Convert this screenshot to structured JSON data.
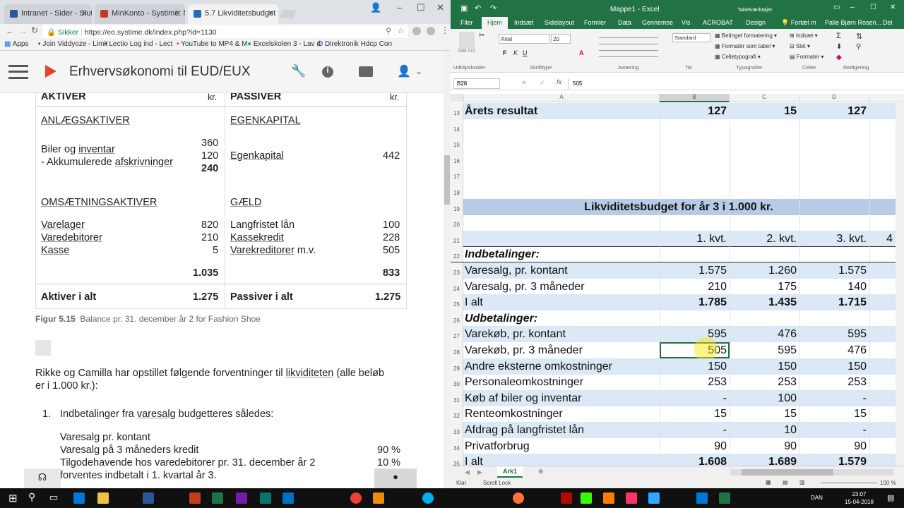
{
  "chrome": {
    "tabs": [
      {
        "label": "Intranet - Sider - Slut m"
      },
      {
        "label": "MinKonto - Systime: Min"
      },
      {
        "label": "5.7 Likviditetsbudget (DC"
      }
    ],
    "secure_label": "Sikker",
    "url": "https://eo.systime.dk/index.php?id=1130",
    "bookmarks": [
      "Apps",
      "Join Viddyoze - Limit",
      "Lectio Log ind - Lect",
      "YouTube to MP4 & M",
      "Excelskolen 3 - Lav d",
      "Direktronik Hdcp Con"
    ]
  },
  "app": {
    "title": "Erhvervsøkonomi til EUD/EUX"
  },
  "balance": {
    "aktiver_header": "AKTIVER",
    "passiver_header": "PASSIVER",
    "currency": "kr.",
    "anlaeg_header": "ANLÆGSAKTIVER",
    "egenkapital_header": "EGENKAPITAL",
    "biler_label": "Biler og",
    "inventar_label": "inventar",
    "akkum_prefix": "- Akkumulerede",
    "afskrivninger_label": "afskrivninger",
    "v360": "360",
    "v120": "120",
    "v240": "240",
    "egenkapital_label": "Egenkapital",
    "v442": "442",
    "oms_header": "OMSÆTNINGSAKTIVER",
    "gaeld_header": "GÆLD",
    "varelager": "Varelager",
    "varedebitorer": "Varedebitorer",
    "kasse": "Kasse",
    "v820": "820",
    "v210": "210",
    "v5": "5",
    "langfristet": "Langfristet lån",
    "kassekredit": "Kassekredit",
    "varekreditorer": "Varekreditorer",
    "mv": "m.v.",
    "v100": "100",
    "v228": "228",
    "v505": "505",
    "sum_oms": "1.035",
    "sum_gaeld": "833",
    "aktiver_i_alt": "Aktiver i alt",
    "passiver_i_alt": "Passiver i alt",
    "total_a": "1.275",
    "total_p": "1.275"
  },
  "figure": {
    "label": "Figur 5.15",
    "caption": "Balance pr. 31. december år 2 for Fashion Shoe"
  },
  "text": {
    "intro_a": "Rikke og Camilla har opstillet følgende forventninger til",
    "intro_link": "likviditeten",
    "intro_b": "(alle beløb",
    "intro_line2": "er i 1.000 kr.):",
    "item1_num": "1.",
    "item1_a": "Indbetalinger fra",
    "item1_link": "varesalg",
    "item1_b": "budgetteres således:",
    "sub1": "Varesalg pr. kontant",
    "sub2": "Varesalg på 3 måneders kredit",
    "sub2_val": "90 %",
    "sub3": "Tilgodehavende hos varedebitorer pr. 31. december år 2",
    "sub3_val": "10 %",
    "sub4": "forventes indbetalt i 1. kvartal år 3."
  },
  "excel": {
    "title": "Mappe1 - Excel",
    "context_label": "Tabelværktøjer",
    "user": "Palle Bjørn Rosen...",
    "tabs": [
      "Filer",
      "Hjem",
      "Indsæt",
      "Sidelayout",
      "Formler",
      "Data",
      "Gennemse",
      "Vis",
      "ACROBAT",
      "Design",
      "Fortæl m",
      "Del"
    ],
    "ribbon": {
      "paste": "Sæt ind",
      "font": "Arial",
      "size": "20",
      "number_format": "Standard",
      "cond_format": "Betinget formatering",
      "format_table": "Formatér som tabel",
      "cell_styles": "Celletypografi",
      "insert": "Indsæt",
      "delete": "Slet",
      "format": "Formatér",
      "groups": [
        "Udklipsholder",
        "Skrifttype",
        "Justering",
        "Tal",
        "Typografier",
        "Celler",
        "Redigering"
      ]
    },
    "name_box": "B28",
    "formula": "505",
    "columns": [
      "A",
      "B",
      "C",
      "D"
    ],
    "rows": [
      {
        "n": "13",
        "a": "Årets resultat",
        "b": "127",
        "c": "15",
        "d": "127",
        "style": "result"
      },
      {
        "n": "14"
      },
      {
        "n": "15"
      },
      {
        "n": "16"
      },
      {
        "n": "17"
      },
      {
        "n": "18"
      },
      {
        "n": "19",
        "title": "Likviditetsbudget for år 3 i 1.000 kr.",
        "style": "title"
      },
      {
        "n": "20"
      },
      {
        "n": "21",
        "b": "1. kvt.",
        "c": "2. kvt.",
        "d": "3. kvt.",
        "e": "4",
        "style": "hdr"
      },
      {
        "n": "22",
        "a": "Indbetalinger:",
        "style": "section"
      },
      {
        "n": "23",
        "a": "Varesalg, pr. kontant",
        "b": "1.575",
        "c": "1.260",
        "d": "1.575",
        "style": "band"
      },
      {
        "n": "24",
        "a": "Varesalg, pr. 3 måneder",
        "b": "210",
        "c": "175",
        "d": "140",
        "style": "plain"
      },
      {
        "n": "25",
        "a": "I alt",
        "b": "1.785",
        "c": "1.435",
        "d": "1.715",
        "style": "total"
      },
      {
        "n": "26",
        "a": "Udbetalinger:",
        "style": "section"
      },
      {
        "n": "27",
        "a": "Varekøb, pr. kontant",
        "b": "595",
        "c": "476",
        "d": "595",
        "style": "band"
      },
      {
        "n": "28",
        "a": "Varekøb, pr. 3 måneder",
        "b": "505",
        "c": "595",
        "d": "476",
        "style": "plain",
        "selected": true
      },
      {
        "n": "29",
        "a": "Andre eksterne omkostninger",
        "b": "150",
        "c": "150",
        "d": "150",
        "style": "band"
      },
      {
        "n": "30",
        "a": "Personaleomkostninger",
        "b": "253",
        "c": "253",
        "d": "253",
        "style": "plain"
      },
      {
        "n": "31",
        "a": "Køb af biler og inventar",
        "b": "-",
        "c": "100",
        "d": "-",
        "style": "band"
      },
      {
        "n": "32",
        "a": "Renteomkostninger",
        "b": "15",
        "c": "15",
        "d": "15",
        "style": "plain"
      },
      {
        "n": "33",
        "a": "Afdrag på langfristet lån",
        "b": "-",
        "c": "10",
        "d": "-",
        "style": "band"
      },
      {
        "n": "34",
        "a": "Privatforbrug",
        "b": "90",
        "c": "90",
        "d": "90",
        "style": "plain"
      },
      {
        "n": "35",
        "a": "I alt",
        "b": "1.608",
        "c": "1.689",
        "d": "1.579",
        "style": "total"
      }
    ],
    "sheet": "Ark1",
    "status_ready": "Klar",
    "status_scroll": "Scroll Lock",
    "zoom": "100 %"
  },
  "taskbar": {
    "time": "23:07",
    "date": "15-04-2018",
    "lang": "DAN"
  },
  "colors": {
    "excel_green": "#217346",
    "band": "#dbe8f5",
    "title_band": "#b6cce6",
    "result_band": "#dbe8f5"
  }
}
